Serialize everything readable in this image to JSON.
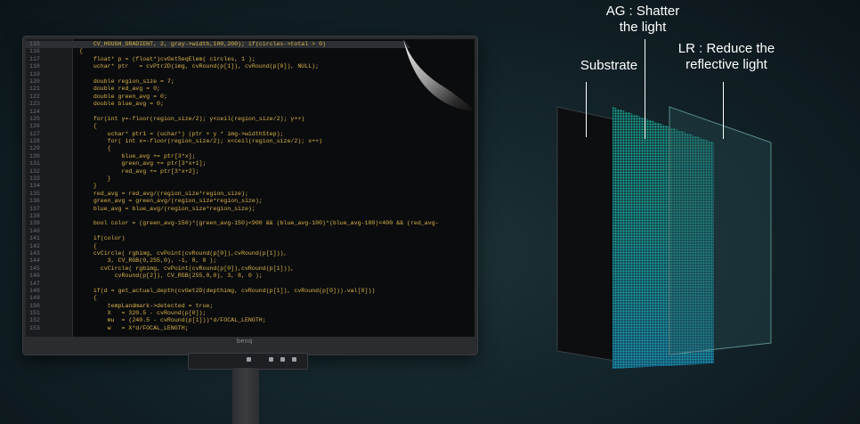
{
  "monitor": {
    "brand": "benq",
    "code_lines": [
      {
        "n": "115",
        "code": "    CV_HOUGH_GRADIENT, 2, gray->width,100,200); if(circles->total > 0)",
        "hl": true
      },
      {
        "n": "116",
        "code": "{"
      },
      {
        "n": "117",
        "code": "    float* p = (float*)cvGetSeqElem( circles, 1 );"
      },
      {
        "n": "118",
        "code": "    uchar* ptr   = cvPtr2D(img, cvRound(p[1]), cvRound(p[0]), NULL);"
      },
      {
        "n": "119",
        "code": ""
      },
      {
        "n": "120",
        "code": "    double region_size = 7;"
      },
      {
        "n": "121",
        "code": "    double red_avg = 0;"
      },
      {
        "n": "122",
        "code": "    double green_avg = 0;"
      },
      {
        "n": "123",
        "code": "    double blue_avg = 0;"
      },
      {
        "n": "124",
        "code": ""
      },
      {
        "n": "125",
        "code": "    for(int y=-floor(region_size/2); y<ceil(region_size/2); y++)"
      },
      {
        "n": "126",
        "code": "    {"
      },
      {
        "n": "127",
        "code": "        uchar* ptr1 = (uchar*) (ptr + y * img->widthStep);"
      },
      {
        "n": "128",
        "code": "        for( int x=-floor(region_size/2); x<ceil(region_size/2); x++)"
      },
      {
        "n": "129",
        "code": "        {"
      },
      {
        "n": "130",
        "code": "            blue_avg += ptr[3*x];"
      },
      {
        "n": "131",
        "code": "            green_avg += ptr[3*x+1];"
      },
      {
        "n": "132",
        "code": "            red_avg += ptr[3*x+2];"
      },
      {
        "n": "133",
        "code": "        }"
      },
      {
        "n": "134",
        "code": "    }"
      },
      {
        "n": "135",
        "code": "    red_avg = red_avg/(region_size*region_size);"
      },
      {
        "n": "136",
        "code": "    green_avg = green_avg/(region_size*region_size);"
      },
      {
        "n": "137",
        "code": "    blue_avg = blue_avg/(region_size*region_size);"
      },
      {
        "n": "138",
        "code": ""
      },
      {
        "n": "139",
        "code": "    bool color = (green_avg-150)*(green_avg-150)<900 && (blue_avg-100)*(blue_avg-100)<400 && (red_avg-"
      },
      {
        "n": "140",
        "code": ""
      },
      {
        "n": "141",
        "code": "    if(color)"
      },
      {
        "n": "142",
        "code": "    {"
      },
      {
        "n": "143",
        "code": "    cvCircle( rgbimg, cvPoint(cvRound(p[0]),cvRound(p[1])),"
      },
      {
        "n": "144",
        "code": "        3, CV_RGB(0,255,0), -1, 8, 0 );"
      },
      {
        "n": "145",
        "code": "      cvCircle( rgbimg, cvPoint(cvRound(p[0]),cvRound(p[1])),"
      },
      {
        "n": "146",
        "code": "          cvRound(p[2]), CV_RGB(255,0,0), 3, 8, 0 );"
      },
      {
        "n": "147",
        "code": ""
      },
      {
        "n": "148",
        "code": "    if(d = get_actual_depth(cvGet2D(depthimg, cvRound(p[1]), cvRound(p[0])).val[0]))"
      },
      {
        "n": "149",
        "code": "    {"
      },
      {
        "n": "150",
        "code": "        tempLandmark->detected = true;"
      },
      {
        "n": "151",
        "code": "        X   = 320.5 - cvRound(p[0]);"
      },
      {
        "n": "152",
        "code": "        mu  = (240.5 - cvRound(p[1]))*d/FOCAL_LENGTH;"
      },
      {
        "n": "153",
        "code": "        w   = X*d/FOCAL_LENGTH;"
      }
    ]
  },
  "layers": {
    "substrate_label": "Substrate",
    "ag_label_line1": "AG : Shatter",
    "ag_label_line2": "the light",
    "lr_label_line1": "LR : Reduce the",
    "lr_label_line2": "reflective light"
  },
  "colors": {
    "code_text": "#d9b44a",
    "ag_green": "#3fd36a",
    "ag_teal": "#1fb8a8",
    "ag_blue": "#1a7fd6"
  }
}
